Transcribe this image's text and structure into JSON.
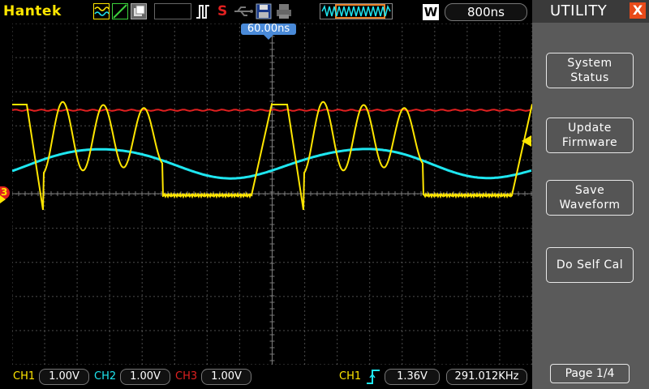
{
  "toolbar": {
    "brand": "Hantek",
    "trigger_status": "S",
    "timebase_mode": "W",
    "timebase": "800ns"
  },
  "marker": {
    "trigger_position": "60.00ns"
  },
  "menu": {
    "title": "UTILITY",
    "close": "X",
    "buttons": [
      {
        "line1": "System",
        "line2": "Status"
      },
      {
        "line1": "Update",
        "line2": "Firmware"
      },
      {
        "line1": "Save",
        "line2": "Waveform"
      },
      {
        "line1": "Do Self Cal",
        "line2": ""
      }
    ],
    "page": "Page 1/4"
  },
  "status": {
    "ch1_label": "CH1",
    "ch1_scale": "1.00V",
    "ch2_label": "CH2",
    "ch2_scale": "1.00V",
    "ch3_label": "CH3",
    "ch3_scale": "1.00V",
    "trig_label": "CH1",
    "trig_level": "1.36V",
    "frequency": "291.012KHz"
  },
  "colors": {
    "ch1": "#ffe600",
    "ch2": "#1ee6f0",
    "ch3": "#e02020",
    "grid": "#6a6a6a",
    "accent": "#4a8ad8"
  },
  "channel_markers": {
    "ch3_marker": "3"
  }
}
